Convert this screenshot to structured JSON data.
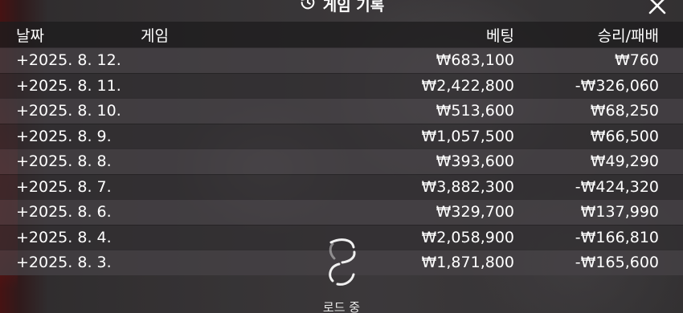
{
  "header": {
    "title": "게임 기록",
    "history_icon": "history-icon",
    "close_icon": "close-icon"
  },
  "table": {
    "columns": {
      "date": "날짜",
      "game": "게임",
      "bet": "베팅",
      "win_loss": "승리/패배"
    },
    "rows": [
      {
        "date": "+2025. 8. 12.",
        "game": "",
        "bet": "₩683,100",
        "win_loss": "₩760"
      },
      {
        "date": "+2025. 8. 11.",
        "game": "",
        "bet": "₩2,422,800",
        "win_loss": "-₩326,060"
      },
      {
        "date": "+2025. 8. 10.",
        "game": "",
        "bet": "₩513,600",
        "win_loss": "₩68,250"
      },
      {
        "date": "+2025. 8. 9.",
        "game": "",
        "bet": "₩1,057,500",
        "win_loss": "₩66,500"
      },
      {
        "date": "+2025. 8. 8.",
        "game": "",
        "bet": "₩393,600",
        "win_loss": "₩49,290"
      },
      {
        "date": "+2025. 8. 7.",
        "game": "",
        "bet": "₩3,882,300",
        "win_loss": "-₩424,320"
      },
      {
        "date": "+2025. 8. 6.",
        "game": "",
        "bet": "₩329,700",
        "win_loss": "₩137,990"
      },
      {
        "date": "+2025. 8. 4.",
        "game": "",
        "bet": "₩2,058,900",
        "win_loss": "-₩166,810"
      },
      {
        "date": "+2025. 8. 3.",
        "game": "",
        "bet": "₩1,871,800",
        "win_loss": "-₩165,600"
      }
    ]
  },
  "loader": {
    "icon": "loading-spinner-icon",
    "text": "로드 중"
  }
}
